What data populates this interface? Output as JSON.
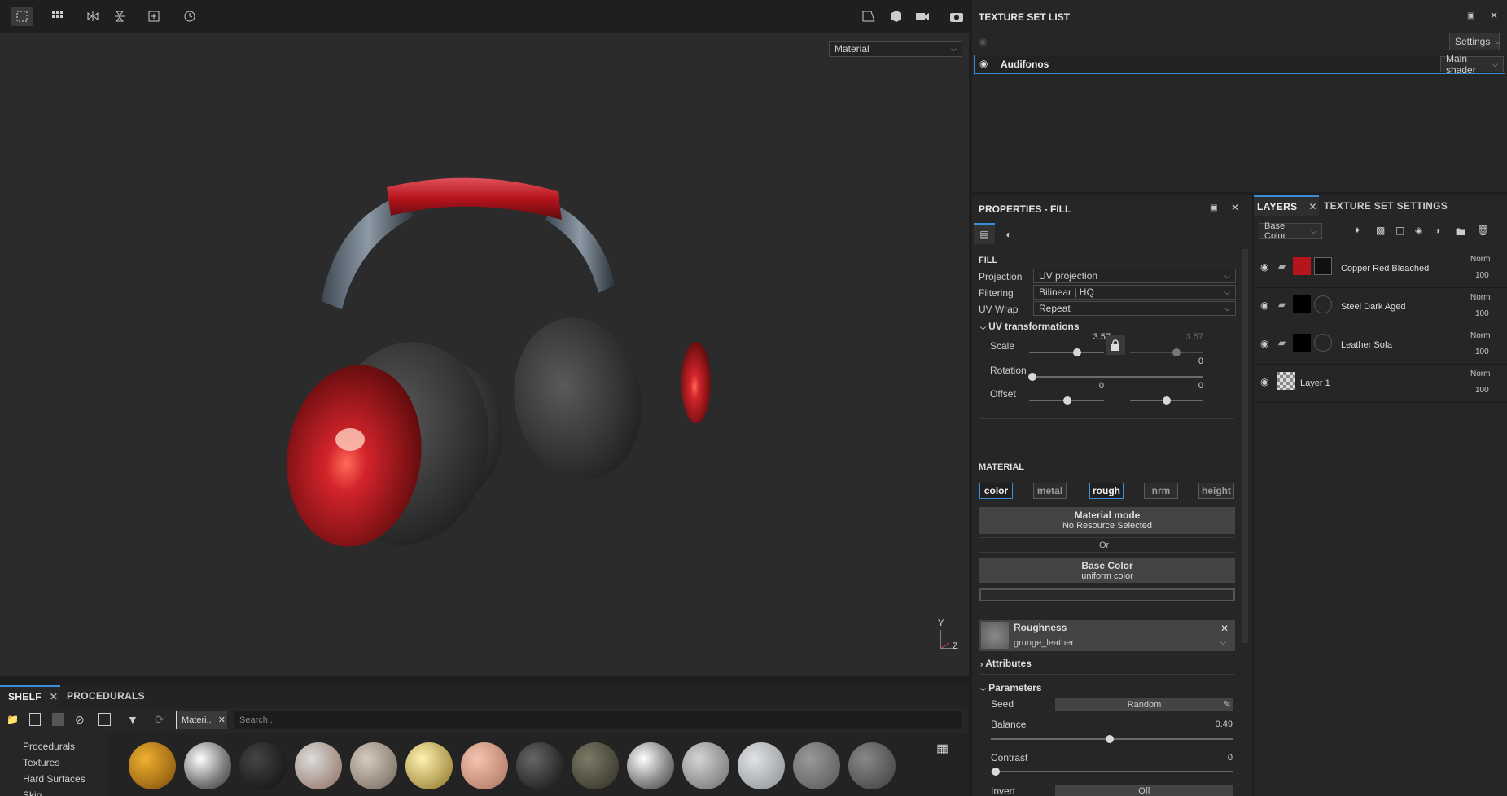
{
  "toolbar": {
    "viewport_mode": "Material"
  },
  "texture_set_list": {
    "title": "TEXTURE SET LIST",
    "settings_label": "Settings",
    "item_name": "Audifonos",
    "shader_label": "Main shader"
  },
  "properties": {
    "title": "PROPERTIES - FILL",
    "fill_section": "FILL",
    "projection_label": "Projection",
    "projection_value": "UV projection",
    "filtering_label": "Filtering",
    "filtering_value": "Bilinear | HQ",
    "uvwrap_label": "UV Wrap",
    "uvwrap_value": "Repeat",
    "uv_transform_label": "UV transformations",
    "scale_label": "Scale",
    "scale_value": "3.57",
    "scale_value_2": "3.57",
    "rotation_label": "Rotation",
    "rotation_value": "0",
    "offset_label": "Offset",
    "offset_x": "0",
    "offset_y": "0",
    "material_section": "MATERIAL",
    "channels": [
      "color",
      "metal",
      "rough",
      "nrm",
      "height"
    ],
    "material_mode_title": "Material mode",
    "material_mode_sub": "No Resource Selected",
    "or_label": "Or",
    "base_color_title": "Base Color",
    "base_color_sub": "uniform color",
    "roughness_title": "Roughness",
    "roughness_sub": "grunge_leather",
    "attributes_label": "Attributes",
    "parameters_label": "Parameters",
    "seed_label": "Seed",
    "seed_value": "Random",
    "balance_label": "Balance",
    "balance_value": "0.49",
    "contrast_label": "Contrast",
    "contrast_value": "0",
    "invert_label": "Invert",
    "invert_value": "Off"
  },
  "layers": {
    "tab_layers": "LAYERS",
    "tab_texture_settings": "TEXTURE SET SETTINGS",
    "channel_select": "Base Color",
    "items": [
      {
        "name": "Copper Red Bleached",
        "blend": "Norm",
        "opacity": "100"
      },
      {
        "name": "Steel Dark Aged",
        "blend": "Norm",
        "opacity": "100"
      },
      {
        "name": "Leather Sofa",
        "blend": "Norm",
        "opacity": "100"
      },
      {
        "name": "Layer 1",
        "blend": "Norm",
        "opacity": "100"
      }
    ]
  },
  "shelf": {
    "tab_shelf": "SHELF",
    "tab_procedurals": "PROCEDURALS",
    "filter_chip": "Materi..",
    "search_placeholder": "Search...",
    "categories": [
      "Procedurals",
      "Textures",
      "Hard Surfaces",
      "Skin"
    ]
  },
  "axis": {
    "y": "Y",
    "z": "Z"
  },
  "colors": {
    "accent": "#3b8ed8",
    "panel": "#262626",
    "viewport": "#2b2b2b",
    "leather_red": "#b5141c"
  }
}
